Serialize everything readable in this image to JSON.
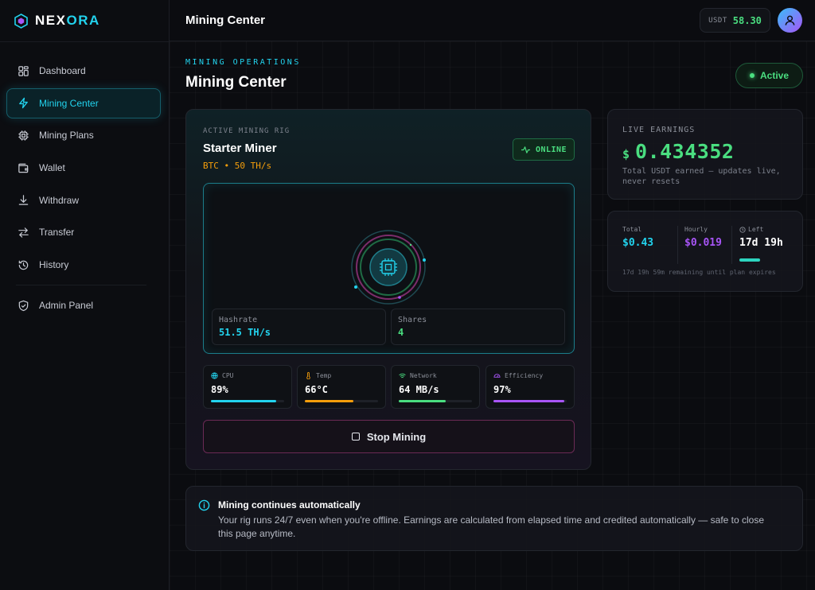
{
  "brand": {
    "name_main": "NEX",
    "name_accent": "ORA"
  },
  "sidebar": {
    "items": [
      {
        "label": "Dashboard",
        "icon": "dashboard-icon"
      },
      {
        "label": "Mining Center",
        "icon": "lightning-icon",
        "active": true
      },
      {
        "label": "Mining Plans",
        "icon": "chip-icon"
      },
      {
        "label": "Wallet",
        "icon": "wallet-icon"
      },
      {
        "label": "Withdraw",
        "icon": "download-icon"
      },
      {
        "label": "Transfer",
        "icon": "transfer-icon"
      },
      {
        "label": "History",
        "icon": "history-icon"
      },
      {
        "label": "Admin Panel",
        "icon": "shield-icon"
      }
    ]
  },
  "topbar": {
    "title": "Mining Center",
    "balance_currency": "USDT",
    "balance_value": "58.30"
  },
  "header": {
    "eyebrow": "MINING OPERATIONS",
    "title": "Mining Center",
    "status": "Active"
  },
  "rig": {
    "eyebrow": "ACTIVE MINING RIG",
    "name": "Starter Miner",
    "subtitle": "BTC • 50 TH/s",
    "status": "ONLINE",
    "hashrate_label": "Hashrate",
    "hashrate_value": "51.5 TH/s",
    "shares_label": "Shares",
    "shares_value": "4",
    "metrics": [
      {
        "label": "CPU",
        "value": "89%",
        "level": 0.89,
        "color": "#22d3ee",
        "icon": "globe-icon"
      },
      {
        "label": "Temp",
        "value": "66°C",
        "level": 0.66,
        "color": "#f59e0b",
        "icon": "thermometer-icon"
      },
      {
        "label": "Network",
        "value": "64 MB/s",
        "level": 0.64,
        "color": "#4ade80",
        "icon": "wifi-icon"
      },
      {
        "label": "Efficiency",
        "value": "97%",
        "level": 0.97,
        "color": "#a855f7",
        "icon": "gauge-icon"
      }
    ],
    "stop_label": "Stop Mining"
  },
  "earnings": {
    "label": "LIVE EARNINGS",
    "currency_symbol": "$",
    "value": "0.434352",
    "note": "Total USDT earned — updates live, never resets"
  },
  "stats": {
    "total_label": "Total",
    "total_value": "$0.43",
    "hourly_label": "Hourly",
    "hourly_value": "$0.019",
    "left_label": "Left",
    "left_value": "17d 19h",
    "remaining_text": "17d 19h 59m remaining until plan expires"
  },
  "info": {
    "title": "Mining continues automatically",
    "body": "Your rig runs 24/7 even when you're offline. Earnings are calculated from elapsed time and credited automatically — safe to close this page anytime."
  },
  "colors": {
    "accent": "#22d3ee",
    "success": "#4ade80",
    "warning": "#f59e0b",
    "purple": "#a855f7"
  }
}
